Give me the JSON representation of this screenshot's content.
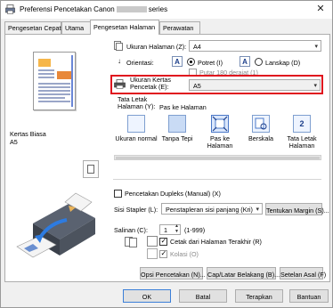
{
  "window": {
    "title_prefix": "Preferensi Pencetakan Canon",
    "title_suffix": "series",
    "close_glyph": "✕"
  },
  "tabs": [
    {
      "label": "Pengesetan Cepat"
    },
    {
      "label": "Utama"
    },
    {
      "label": "Pengesetan Halaman"
    },
    {
      "label": "Perawatan"
    }
  ],
  "preview": {
    "media_type": "Kertas Biasa",
    "paper_size": "A5"
  },
  "page_setup": {
    "page_size_label": "Ukuran Halaman (Z):",
    "page_size_value": "A4",
    "orientation_label": "Orientasi:",
    "portrait_label": "Potret (I)",
    "landscape_label": "Lanskap (D)",
    "rotate_label": "Putar 180 derajat (1)",
    "printer_paper_label": "Ukuran Kertas\nPencetak (E):",
    "printer_paper_value": "A5",
    "layout_label": "Tata Letak\nHalaman (Y):",
    "fit_to_page_label": "Pas ke Halaman",
    "layouts": [
      {
        "name": "Ukuran normal"
      },
      {
        "name": "Tanpa Tepi"
      },
      {
        "name": "Pas ke\nHalaman"
      },
      {
        "name": "Berskala"
      },
      {
        "name": "Tata Letak\nHalaman"
      }
    ],
    "duplex_label": "Pencetakan Dupleks (Manual) (X)",
    "stapling_label": "Sisi Stapler (L):",
    "stapling_value": "Penstapleran sisi panjang (Kri)",
    "margin_button": "Tentukan Margin (S)...",
    "copies_label": "Salinan (C):",
    "copies_value": "1",
    "copies_range": "(1-999)",
    "last_page_label": "Cetak dari Halaman Terakhir (R)",
    "collate_label": "Kolasi (O)",
    "page_options_button": "Opsi Pencetakan (N)...",
    "stamp_button": "Cap/Latar Belakang (B)...",
    "defaults_button": "Setelan Asal (F)"
  },
  "footer": {
    "ok": "OK",
    "cancel": "Batal",
    "apply": "Terapkan",
    "help": "Bantuan"
  },
  "colors": {
    "highlight_frame": "#e0141e",
    "primary_button_border": "#3b7fd8"
  }
}
